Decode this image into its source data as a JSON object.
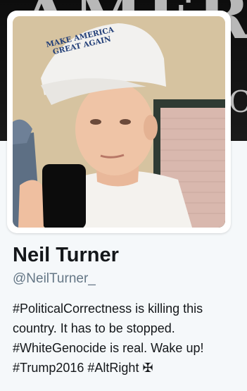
{
  "banner": {
    "text": "AMER",
    "side_letter": "C"
  },
  "cap": {
    "line1": "MAKE AMERICA",
    "line2": "GREAT AGAIN"
  },
  "profile": {
    "name": "Neil Turner",
    "handle": "@NeilTurner_"
  },
  "bio": {
    "line1": {
      "tag": "#PoliticalCorrectness",
      "rest": " is killing this"
    },
    "line2": "country. It has to be stopped.",
    "line3": {
      "tag": "#WhiteGenocide",
      "rest": " is real. Wake up!"
    },
    "line4": {
      "tag1": "#Trump2016",
      "tag2": "#AltRight",
      "symbol": "✠"
    }
  },
  "colors": {
    "background": "#f5f8fa",
    "name": "#14171a",
    "handle": "#657786"
  }
}
